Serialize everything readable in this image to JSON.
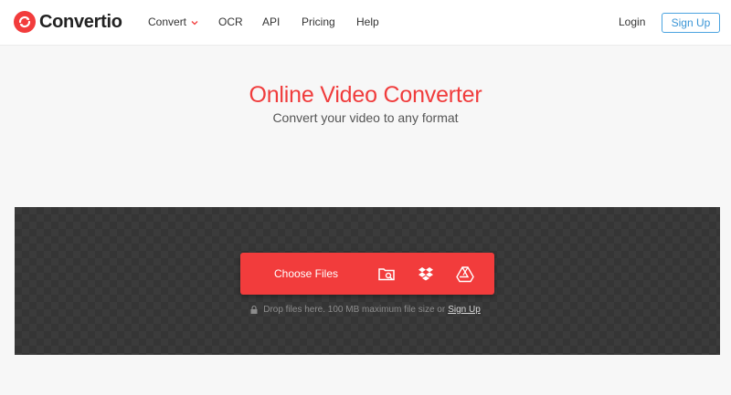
{
  "brand": {
    "name": "Convertio",
    "accent": "#f23c3c"
  },
  "nav": {
    "items": [
      {
        "label": "Convert",
        "has_dropdown": true
      },
      {
        "label": "OCR"
      },
      {
        "label": "API"
      },
      {
        "label": "Pricing"
      },
      {
        "label": "Help"
      }
    ],
    "login_label": "Login",
    "signup_label": "Sign Up"
  },
  "hero": {
    "title": "Online Video Converter",
    "subtitle": "Convert your video to any format"
  },
  "upload": {
    "choose_label": "Choose Files",
    "sources": [
      "folder-search-icon",
      "dropbox-icon",
      "google-drive-icon"
    ],
    "hint_text": "Drop files here. 100 MB maximum file size or",
    "hint_link": "Sign Up"
  }
}
